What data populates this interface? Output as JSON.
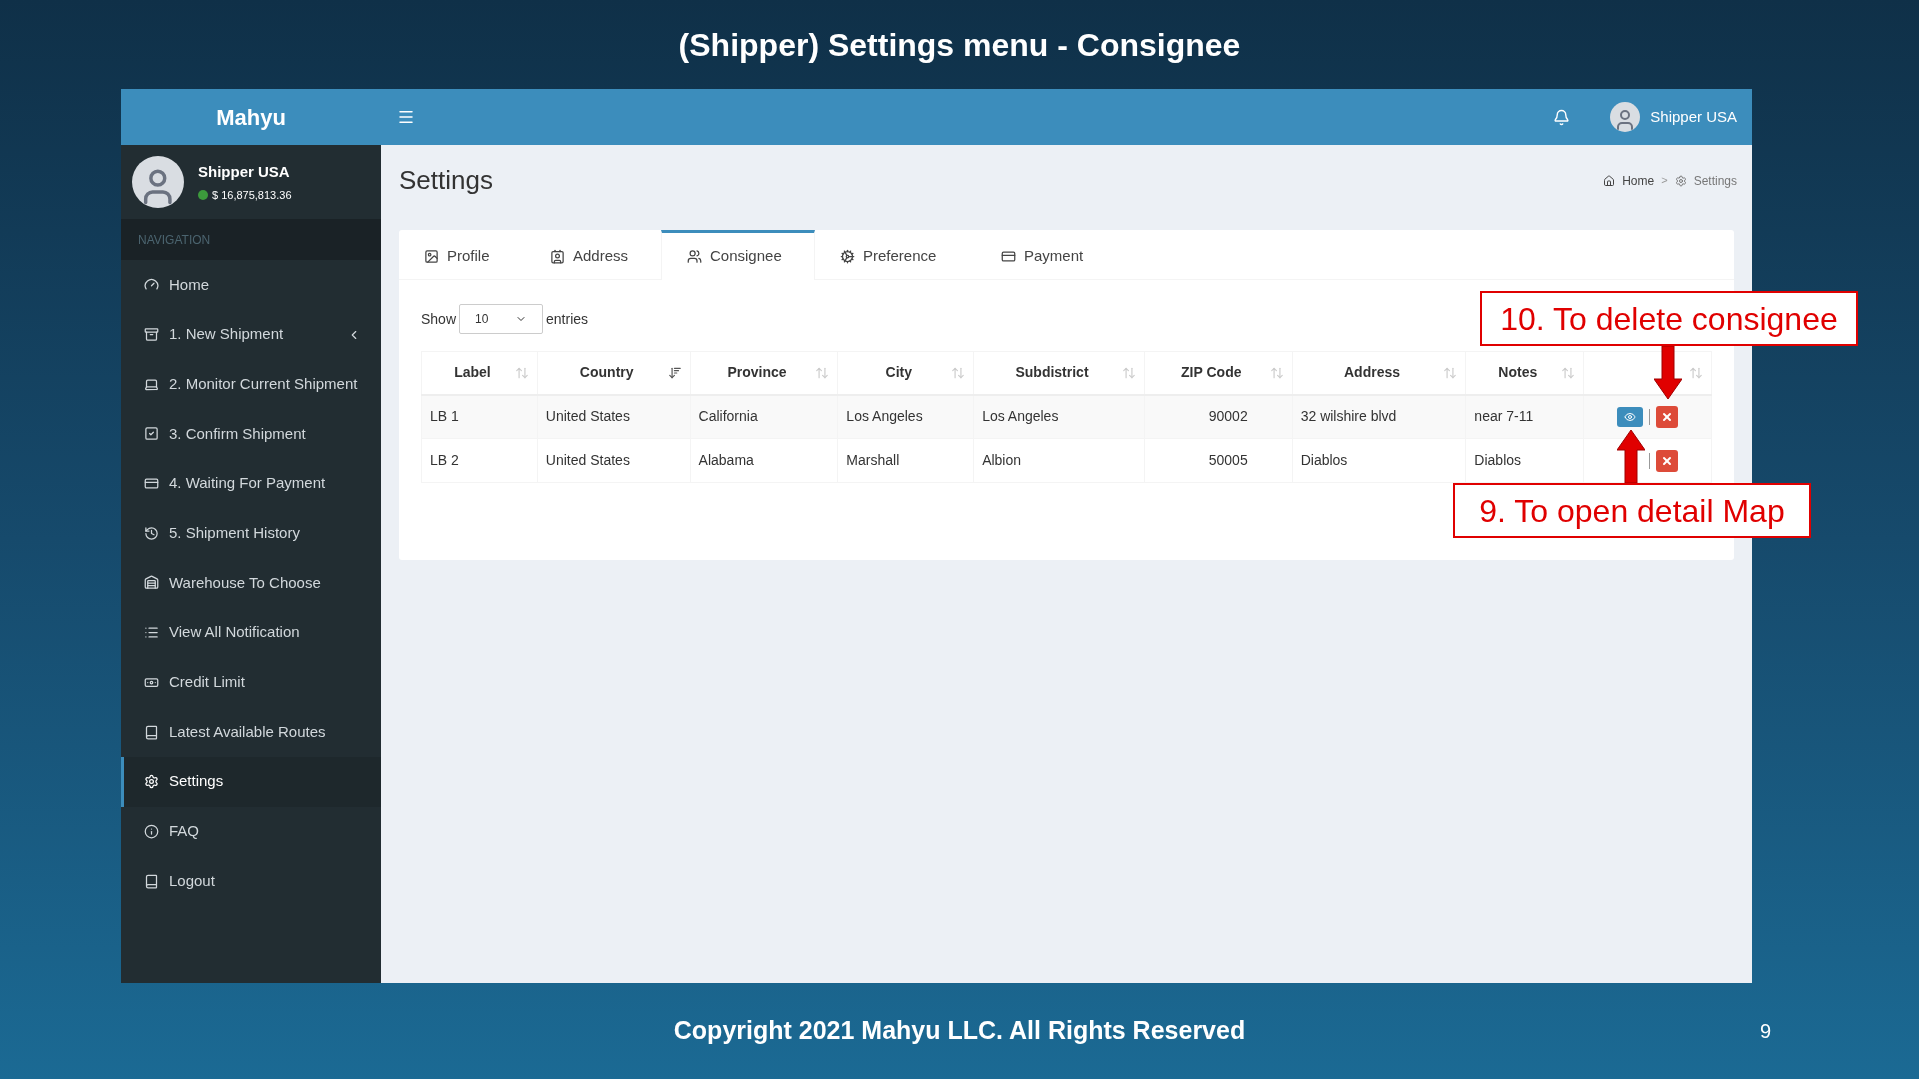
{
  "slide": {
    "title": "(Shipper) Settings menu - Consignee",
    "footer": "Copyright 2021 Mahyu LLC. All Rights Reserved",
    "page_number": "9"
  },
  "sidebar": {
    "brand": "Mahyu",
    "user": {
      "name": "Shipper USA",
      "balance": "$ 16,875,813.36",
      "online": true
    },
    "section": "NAVIGATION",
    "items": [
      {
        "label": "Home",
        "selected": false,
        "submenu": false
      },
      {
        "label": "1. New Shipment",
        "selected": false,
        "submenu": true
      },
      {
        "label": "2. Monitor Current Shipment",
        "selected": false,
        "submenu": false
      },
      {
        "label": "3. Confirm Shipment",
        "selected": false,
        "submenu": false
      },
      {
        "label": "4. Waiting For Payment",
        "selected": false,
        "submenu": false
      },
      {
        "label": "5. Shipment History",
        "selected": false,
        "submenu": false
      },
      {
        "label": "Warehouse To Choose",
        "selected": false,
        "submenu": false
      },
      {
        "label": "View All Notification",
        "selected": false,
        "submenu": false
      },
      {
        "label": "Credit Limit",
        "selected": false,
        "submenu": false
      },
      {
        "label": "Latest Available Routes",
        "selected": false,
        "submenu": false
      },
      {
        "label": "Settings",
        "selected": true,
        "submenu": false
      },
      {
        "label": "FAQ",
        "selected": false,
        "submenu": false
      },
      {
        "label": "Logout",
        "selected": false,
        "submenu": false
      }
    ]
  },
  "topbar": {
    "user": "Shipper USA"
  },
  "page": {
    "title": "Settings",
    "breadcrumb": [
      "Home",
      "Settings"
    ],
    "breadcrumb_separator": ">"
  },
  "tabs": [
    {
      "label": "Profile",
      "selected": false
    },
    {
      "label": "Address",
      "selected": false
    },
    {
      "label": "Consignee",
      "selected": true
    },
    {
      "label": "Preference",
      "selected": false
    },
    {
      "label": "Payment",
      "selected": false
    }
  ],
  "table": {
    "show_label": "Show",
    "page_size": "10",
    "entries_label": "entries",
    "columns": [
      {
        "label": "Label",
        "sorted": false
      },
      {
        "label": "Country",
        "sorted": true
      },
      {
        "label": "Province",
        "sorted": false
      },
      {
        "label": "City",
        "sorted": false
      },
      {
        "label": "Subdistrict",
        "sorted": false
      },
      {
        "label": "ZIP Code",
        "sorted": false
      },
      {
        "label": "Address",
        "sorted": false
      },
      {
        "label": "Notes",
        "sorted": false
      },
      {
        "sorted": false
      }
    ],
    "rows": [
      {
        "cells": [
          "LB 1",
          "United States",
          "California",
          "Los Angeles",
          "Los Angeles",
          "90002",
          "32 wilshire blvd",
          "near 7-11"
        ],
        "view_button": true
      },
      {
        "cells": [
          "LB 2",
          "United States",
          "Alabama",
          "Marshall",
          "Albion",
          "50005",
          "Diablos",
          "Diablos"
        ],
        "view_button": false
      }
    ]
  },
  "annotations": [
    {
      "text": "10. To delete consignee",
      "kind": "down"
    },
    {
      "text": "9. To open detail Map",
      "kind": "up"
    }
  ]
}
